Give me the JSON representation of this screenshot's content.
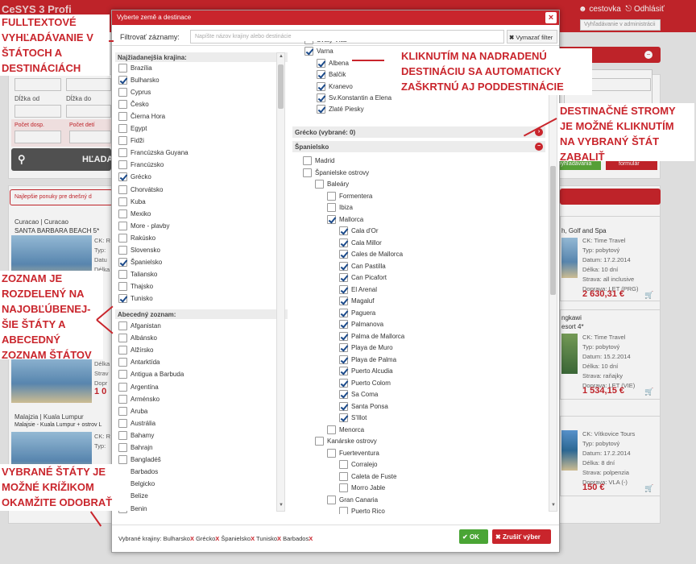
{
  "app": {
    "logo": "CeSYS 3 Profi",
    "user": "cestovka",
    "logout": "Odhlásiť",
    "admin_placeholder": "Vyhľadávanie v administrácii",
    "fields": [
      "Dĺžka od",
      "Dĺžka do",
      "Počet dosp.",
      "Počet detí"
    ],
    "search_button": "HĽADAŤ",
    "extra_buttons": [
      "vyhľadávania",
      "formulár"
    ],
    "offers_title": "Najlepšie ponuky pre dnešný d",
    "cards": [
      {
        "title": "Curacao | Curacao",
        "subtitle": "SANTA BARBARA BEACH 5*"
      },
      {
        "title": "Malajzia | Kuala Lumpur",
        "subtitle": "Malajsie - Kuala Lumpur + ostrov L"
      }
    ],
    "right_cards": [
      {
        "subtitle": "h, Golf and Spa",
        "lines": [
          "CK: Time Travel",
          "Typ: pobytový",
          "Datum: 17.2.2014",
          "Délka: 10 dní",
          "Strava: all inclusive",
          "Doprava: LET (PRG)"
        ],
        "price": "2 630,31 €"
      },
      {
        "subtitle": "ngkawi",
        "subtitle2": "esort 4*",
        "lines": [
          "CK: Time Travel",
          "Typ: pobytový",
          "Datum: 15.2.2014",
          "Délka: 10 dní",
          "Strava: raňajky",
          "Doprava: LET (VIE)"
        ],
        "price": "1 534,15 €"
      },
      {
        "subtitle": "",
        "lines": [
          "CK: Vítkovice Tours",
          "Typ: pobytový",
          "Datum: 17.2.2014",
          "Délka: 8 dní",
          "Strava: polpenzia",
          "Doprava: VLA (-)"
        ],
        "price": "150 €"
      }
    ],
    "left_card_lines": [
      "CK: R",
      "Typ:",
      "Datu",
      "Délka",
      "Strav",
      "Dopr"
    ],
    "left_price": "1 0"
  },
  "modal": {
    "title": "Vyberte země a destinace",
    "filter_label": "Filtrovať záznamy:",
    "filter_placeholder": "Napíšte názov krajiny alebo destinácie",
    "clear_filter": "Vymazať filter",
    "popular_head": "Najžiadanejšia krajina:",
    "popular": [
      {
        "label": "Brazília",
        "checked": false
      },
      {
        "label": "Bulharsko",
        "checked": true
      },
      {
        "label": "Cyprus",
        "checked": false
      },
      {
        "label": "Česko",
        "checked": false
      },
      {
        "label": "Čierna Hora",
        "checked": false
      },
      {
        "label": "Egypt",
        "checked": false
      },
      {
        "label": "Fidži",
        "checked": false
      },
      {
        "label": "Francúzska Guyana",
        "checked": false
      },
      {
        "label": "Francúzsko",
        "checked": false
      },
      {
        "label": "Grécko",
        "checked": true
      },
      {
        "label": "Chorvátsko",
        "checked": false
      },
      {
        "label": "Kuba",
        "checked": false
      },
      {
        "label": "Mexiko",
        "checked": false
      },
      {
        "label": "More - plavby",
        "checked": false
      },
      {
        "label": "Rakúsko",
        "checked": false
      },
      {
        "label": "Slovensko",
        "checked": false
      },
      {
        "label": "Španielsko",
        "checked": true
      },
      {
        "label": "Taliansko",
        "checked": false
      },
      {
        "label": "Thajsko",
        "checked": false
      },
      {
        "label": "Tunisko",
        "checked": true
      }
    ],
    "alpha_head": "Abecedný zoznam:",
    "alpha": [
      {
        "label": "Afganistan",
        "checked": false
      },
      {
        "label": "Albánsko",
        "checked": false
      },
      {
        "label": "Alžírsko",
        "checked": false
      },
      {
        "label": "Antarktída",
        "checked": false
      },
      {
        "label": "Antigua a Barbuda",
        "checked": false
      },
      {
        "label": "Argentína",
        "checked": false
      },
      {
        "label": "Arménsko",
        "checked": false
      },
      {
        "label": "Aruba",
        "checked": false
      },
      {
        "label": "Austrália",
        "checked": false
      },
      {
        "label": "Bahamy",
        "checked": false
      },
      {
        "label": "Bahrajn",
        "checked": false
      },
      {
        "label": "Bangladéš",
        "checked": false
      },
      {
        "label": "Barbados",
        "checked": true
      },
      {
        "label": "Belgicko",
        "checked": false
      },
      {
        "label": "Belize",
        "checked": false
      },
      {
        "label": "Benin",
        "checked": false
      }
    ],
    "tree": [
      {
        "label": "Svätý Vlas",
        "checked": false,
        "level": 1
      },
      {
        "label": "Varna",
        "checked": true,
        "level": 1
      },
      {
        "label": "Albena",
        "checked": true,
        "level": 2
      },
      {
        "label": "Balčik",
        "checked": true,
        "level": 2
      },
      {
        "label": "Kranevo",
        "checked": true,
        "level": 2
      },
      {
        "label": "Sv.Konstantin a Elena",
        "checked": true,
        "level": 2
      },
      {
        "label": "Zlaté Piesky",
        "checked": true,
        "level": 2
      }
    ],
    "greece_head": "Grécko (vybrané: 0)",
    "spain_head": "Španielsko",
    "spain_tree": [
      {
        "label": "Madrid",
        "checked": false,
        "level": 1
      },
      {
        "label": "Španielske ostrovy",
        "checked": false,
        "level": 1
      },
      {
        "label": "Baleáry",
        "checked": false,
        "level": 2
      },
      {
        "label": "Formentera",
        "checked": false,
        "level": 3
      },
      {
        "label": "Ibiza",
        "checked": false,
        "level": 3
      },
      {
        "label": "Mallorca",
        "checked": true,
        "level": 3
      },
      {
        "label": "Cala d'Or",
        "checked": true,
        "level": 4
      },
      {
        "label": "Cala Millor",
        "checked": true,
        "level": 4
      },
      {
        "label": "Cales de Mallorca",
        "checked": true,
        "level": 4
      },
      {
        "label": "Can Pastilla",
        "checked": true,
        "level": 4
      },
      {
        "label": "Can Picafort",
        "checked": true,
        "level": 4
      },
      {
        "label": "El Arenal",
        "checked": true,
        "level": 4
      },
      {
        "label": "Magaluf",
        "checked": true,
        "level": 4
      },
      {
        "label": "Paguera",
        "checked": true,
        "level": 4
      },
      {
        "label": "Palmanova",
        "checked": true,
        "level": 4
      },
      {
        "label": "Palma de Mallorca",
        "checked": true,
        "level": 4
      },
      {
        "label": "Playa de Muro",
        "checked": true,
        "level": 4
      },
      {
        "label": "Playa de Palma",
        "checked": true,
        "level": 4
      },
      {
        "label": "Puerto Alcudia",
        "checked": true,
        "level": 4
      },
      {
        "label": "Puerto Colom",
        "checked": true,
        "level": 4
      },
      {
        "label": "Sa Coma",
        "checked": true,
        "level": 4
      },
      {
        "label": "Santa Ponsa",
        "checked": true,
        "level": 4
      },
      {
        "label": "S'Illot",
        "checked": true,
        "level": 4
      },
      {
        "label": "Menorca",
        "checked": false,
        "level": 3
      },
      {
        "label": "Kanárske ostrovy",
        "checked": false,
        "level": 2
      },
      {
        "label": "Fuerteventura",
        "checked": false,
        "level": 3
      },
      {
        "label": "Corralejo",
        "checked": false,
        "level": 4
      },
      {
        "label": "Caleta de Fuste",
        "checked": false,
        "level": 4
      },
      {
        "label": "Morro Jable",
        "checked": false,
        "level": 4
      },
      {
        "label": "Gran Canaria",
        "checked": false,
        "level": 3
      },
      {
        "label": "Puerto Rico",
        "checked": false,
        "level": 4
      }
    ],
    "selected_label": "Vybrané krajiny:",
    "selected": [
      "Bulharsko",
      "Grécko",
      "Španielsko",
      "Tunisko",
      "Barbados"
    ],
    "remove_mark": "X",
    "ok": "OK",
    "cancel": "Zrušiť výber"
  },
  "annotations": {
    "fulltext": [
      "FULLTEXTOVÉ",
      "VYHĽADÁVANIE V",
      "ŠTÁTOCH A",
      "DESTINÁCIÁCH"
    ],
    "parent": [
      "KLIKNUTÍM NA NADRADENÚ",
      "DESTINÁCIU SA AUTOMATICKY",
      "ZAŠKRTNÚ AJ PODDESTINÁCIE"
    ],
    "trees": [
      "DESTINAČNÉ STROMY",
      "JE MOŽNÉ KLIKNUTÍM",
      "NA VYBRANÝ ŠTÁT",
      "ZABALIŤ"
    ],
    "list": [
      "ZOZNAM JE",
      "ROZDELENÝ NA",
      "NAJOBĽÚBENEJ-",
      "ŠIE ŠTÁTY A",
      "ABECEDNÝ",
      "ZOZNAM ŠTÁTOV"
    ],
    "remove": [
      "VYBRANÉ ŠTÁTY JE",
      "MOŽNÉ KRÍŽIKOM",
      "OKAMŽITE ODOBRAŤ"
    ]
  },
  "colors": {
    "accent": "#c9252c",
    "check": "#1b4a8a",
    "ok": "#4aa535"
  }
}
